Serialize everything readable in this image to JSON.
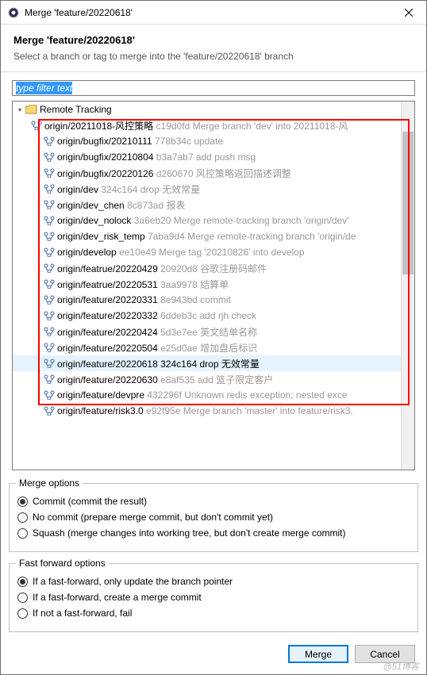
{
  "titlebar": {
    "title": "Merge 'feature/20220618'"
  },
  "header": {
    "title": "Merge 'feature/20220618'",
    "subtitle": "Select a branch or tag to merge into the 'feature/20220618' branch"
  },
  "filter": {
    "placeholder": "type filter text"
  },
  "tree": {
    "root_label": "Remote Tracking",
    "nodes": [
      {
        "lvl": 1,
        "name": "origin/20211018-风控策略",
        "msg": "c19d0fd Merge branch 'dev' into 20211018-风"
      },
      {
        "lvl": 2,
        "name": "origin/bugfix/20210111",
        "msg": "778b34c update"
      },
      {
        "lvl": 2,
        "name": "origin/bugfix/20210804",
        "msg": "b3a7ab7 add push msg"
      },
      {
        "lvl": 2,
        "name": "origin/bugfix/20220126",
        "msg": "d260670 风控策略返回描述调整"
      },
      {
        "lvl": 2,
        "name": "origin/dev",
        "msg": "324c164 drop 无效常量"
      },
      {
        "lvl": 2,
        "name": "origin/dev_chen",
        "msg": "8c873ad 报表"
      },
      {
        "lvl": 2,
        "name": "origin/dev_nolock",
        "msg": "3a6eb20 Merge remote-tracking branch 'origin/dev'"
      },
      {
        "lvl": 2,
        "name": "origin/dev_risk_temp",
        "msg": "7aba9d4 Merge remote-tracking branch 'origin/de"
      },
      {
        "lvl": 2,
        "name": "origin/develop",
        "msg": "ee10e49 Merge tag '20210826' into develop"
      },
      {
        "lvl": 2,
        "name": "origin/featrue/20220429",
        "msg": "20920d8 谷歌注册码邮件"
      },
      {
        "lvl": 2,
        "name": "origin/featrue/20220531",
        "msg": "3aa9978 结算单"
      },
      {
        "lvl": 2,
        "name": "origin/feature/20220331",
        "msg": "8e943bd commit"
      },
      {
        "lvl": 2,
        "name": "origin/feature/20220332",
        "msg": "6ddeb3c add rjh check"
      },
      {
        "lvl": 2,
        "name": "origin/feature/20220424",
        "msg": "5d3e7ee 英文结单名称"
      },
      {
        "lvl": 2,
        "name": "origin/feature/20220504",
        "msg": "e25d0ae 增加盘后标识"
      },
      {
        "lvl": 2,
        "name": "origin/feature/20220618",
        "msg": "324c164 drop 无效常量",
        "selected": true
      },
      {
        "lvl": 2,
        "name": "origin/feature/20220630",
        "msg": "e8af535 add 篮子限定客户"
      },
      {
        "lvl": 2,
        "name": "origin/feature/devpre",
        "msg": "432296f  Unknown redis exception; nested exce"
      },
      {
        "lvl": 2,
        "name": "origin/feature/risk3.0",
        "msg": "e92f95e Merge branch 'master' into feature/risk3."
      }
    ]
  },
  "merge_options": {
    "legend": "Merge options",
    "opts": [
      {
        "label": "Commit (commit the result)",
        "checked": true
      },
      {
        "label": "No commit (prepare merge commit, but don't commit yet)",
        "checked": false
      },
      {
        "label": "Squash (merge changes into working tree, but don't create merge commit)",
        "checked": false
      }
    ]
  },
  "ff_options": {
    "legend": "Fast forward options",
    "opts": [
      {
        "label": "If a fast-forward, only update the branch pointer",
        "checked": true
      },
      {
        "label": "If a fast-forward, create a merge commit",
        "checked": false
      },
      {
        "label": "If not a fast-forward, fail",
        "checked": false
      }
    ]
  },
  "footer": {
    "merge_label": "Merge",
    "cancel_label": "Cancel"
  },
  "watermark": "@51博客"
}
